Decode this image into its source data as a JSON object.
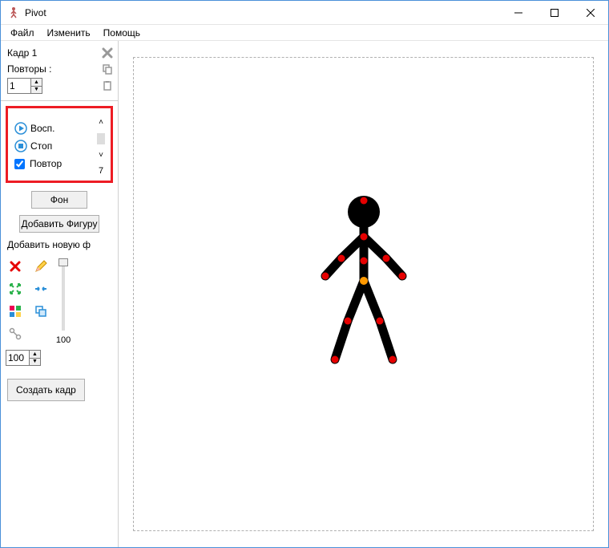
{
  "window": {
    "title": "Pivot"
  },
  "menu": {
    "file": "Файл",
    "edit": "Изменить",
    "help": "Помощь"
  },
  "frame": {
    "label": "Кадр 1",
    "repeats_label": "Повторы :",
    "repeats_value": "1"
  },
  "playback": {
    "play_label": "Восп.",
    "stop_label": "Стоп",
    "loop_label": "Повтор",
    "loop_checked": true,
    "speed_value": "7"
  },
  "buttons": {
    "background": "Фон",
    "add_figure": "Добавить Фигуру",
    "add_new_label": "Добавить новую ф",
    "create_frame": "Создать кадр"
  },
  "tools": {
    "scale_value": "100",
    "scale_display": "100"
  }
}
